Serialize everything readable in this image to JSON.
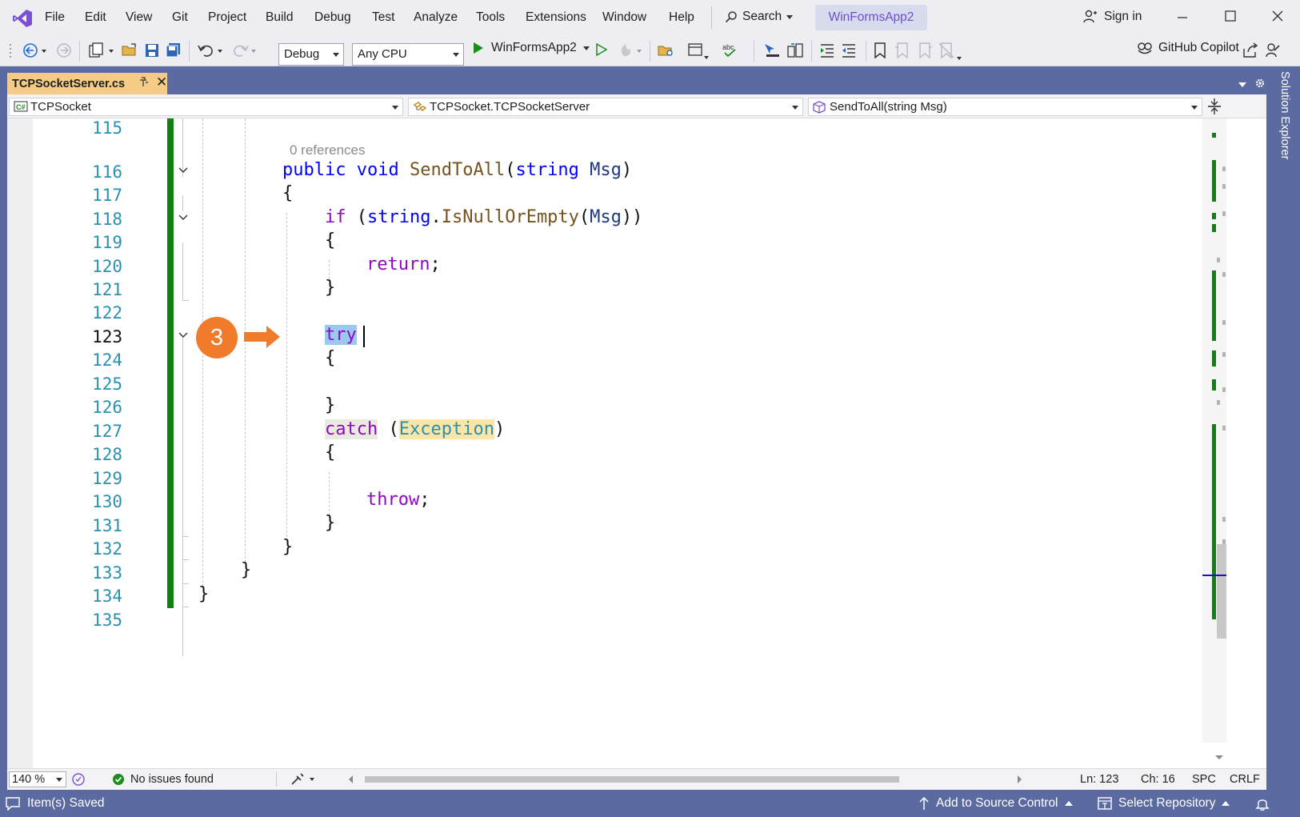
{
  "menu": [
    "File",
    "Edit",
    "View",
    "Git",
    "Project",
    "Build",
    "Debug",
    "Test",
    "Analyze",
    "Tools",
    "Extensions",
    "Window",
    "Help"
  ],
  "titlebar": {
    "search_label": "Search",
    "solution_name": "WinFormsApp2",
    "signin_label": "Sign in"
  },
  "toolbar": {
    "config_value": "Debug",
    "platform_value": "Any CPU",
    "run_target": "WinFormsApp2",
    "copilot_label": "GitHub Copilot"
  },
  "tab": {
    "filename": "TCPSocketServer.cs"
  },
  "side_panel": {
    "label": "Solution Explorer"
  },
  "navbar": {
    "project": "TCPSocket",
    "type": "TCPSocket.TCPSocketServer",
    "member": "SendToAll(string Msg)"
  },
  "editor": {
    "codelens": "0 references",
    "callout_number": "3",
    "line_numbers": [
      "115",
      "116",
      "117",
      "118",
      "119",
      "120",
      "121",
      "122",
      "123",
      "124",
      "125",
      "126",
      "127",
      "128",
      "129",
      "130",
      "131",
      "132",
      "133",
      "134",
      "135"
    ],
    "tokens": {
      "public": "public",
      "void": "void",
      "method": "SendToAll",
      "lparen": "(",
      "string": "string",
      "param": "Msg",
      "rparen": ")",
      "open_brace": "{",
      "close_brace": "}",
      "if": "if",
      "string_type": "string",
      "dot": ".",
      "isnull": "IsNullOrEmpty",
      "if_arg_open": "(",
      "if_arg": "Msg",
      "if_close": "))",
      "if_open": "(",
      "return": "return",
      "semi": ";",
      "try": "try",
      "catch": "catch",
      "exception": "Exception",
      "throw": "throw"
    }
  },
  "editor_status": {
    "zoom": "140 %",
    "issues": "No issues found",
    "line": "Ln: 123",
    "column": "Ch: 16",
    "spacing": "SPC",
    "line_ending": "CRLF"
  },
  "statusbar": {
    "message": "Item(s) Saved",
    "source_control": "Add to Source Control",
    "repository": "Select Repository"
  },
  "colors": {
    "accent": "#5b6aa0",
    "change_bar": "#108010",
    "callout": "#f07b2b",
    "tab_active": "#f5cc84"
  }
}
